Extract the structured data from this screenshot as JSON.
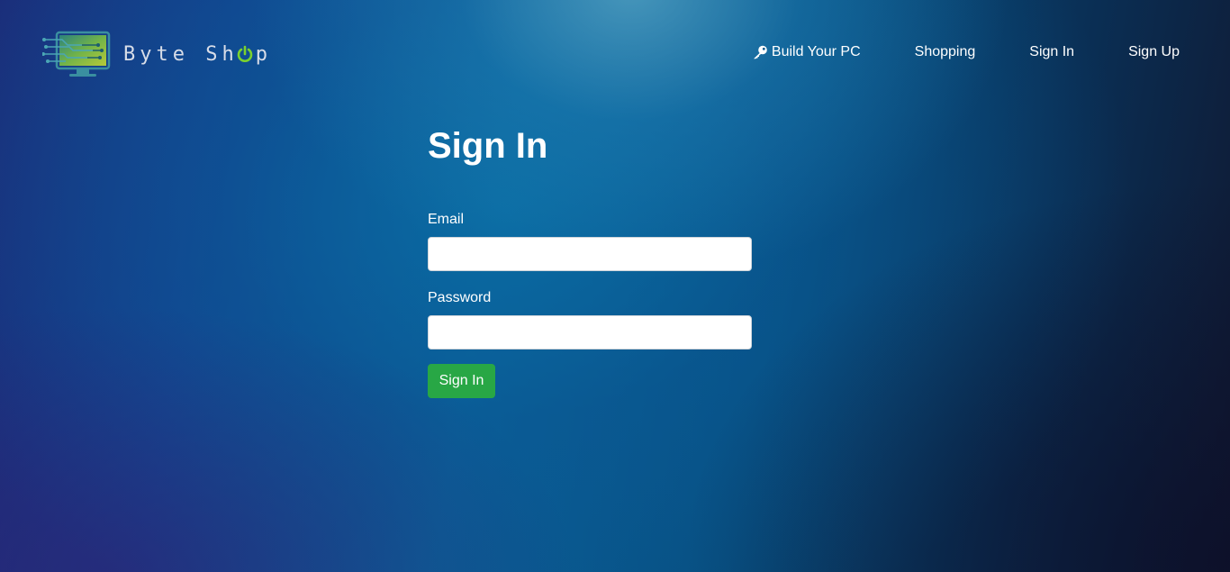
{
  "brand": {
    "name_part1": "Byte Sh",
    "name_part2": "p"
  },
  "nav": {
    "items": [
      {
        "label": "Build Your PC",
        "icon": "key-icon"
      },
      {
        "label": "Shopping"
      },
      {
        "label": "Sign In"
      },
      {
        "label": "Sign Up"
      }
    ]
  },
  "form": {
    "title": "Sign In",
    "email_label": "Email",
    "email_value": "",
    "password_label": "Password",
    "password_value": "",
    "submit_label": "Sign In"
  },
  "colors": {
    "accent_green": "#28a745",
    "logo_green": "#7bd12e",
    "background_blue": "#0a5f98"
  }
}
